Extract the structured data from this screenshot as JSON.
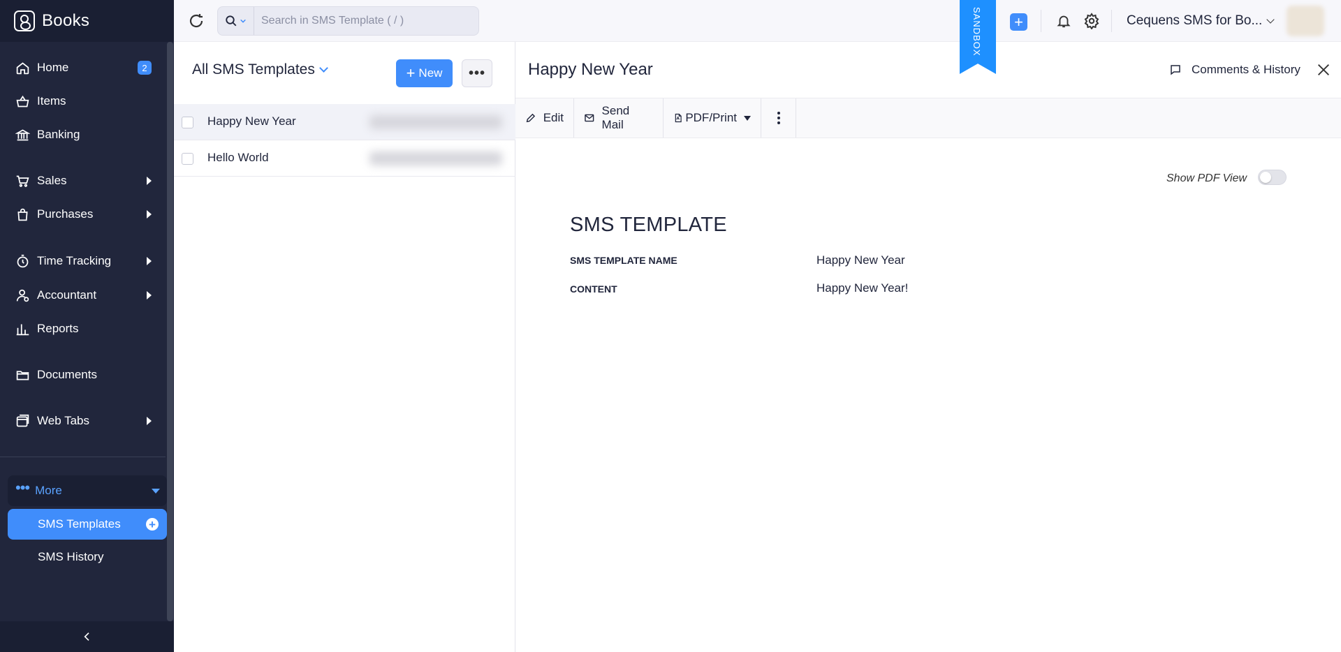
{
  "app": {
    "name": "Books"
  },
  "sidebar": {
    "items": [
      {
        "label": "Home",
        "icon": "home-icon",
        "badge": "2"
      },
      {
        "label": "Items",
        "icon": "basket-icon"
      },
      {
        "label": "Banking",
        "icon": "bank-icon"
      },
      {
        "label": "Sales",
        "icon": "cart-icon",
        "has_submenu": true
      },
      {
        "label": "Purchases",
        "icon": "bag-icon",
        "has_submenu": true
      },
      {
        "label": "Time Tracking",
        "icon": "timer-icon",
        "has_submenu": true
      },
      {
        "label": "Accountant",
        "icon": "user-icon",
        "has_submenu": true
      },
      {
        "label": "Reports",
        "icon": "bar-chart-icon"
      },
      {
        "label": "Documents",
        "icon": "folder-icon"
      },
      {
        "label": "Web Tabs",
        "icon": "tabs-icon",
        "has_submenu": true
      }
    ],
    "more": {
      "label": "More"
    },
    "sub_items": [
      {
        "label": "SMS Templates",
        "active": true
      },
      {
        "label": "SMS History",
        "active": false
      }
    ]
  },
  "topbar": {
    "search_placeholder": "Search in SMS Template ( / )",
    "sandbox_label": "SANDBOX",
    "org_name": "Cequens SMS for Bo..."
  },
  "list": {
    "view_title": "All SMS Templates",
    "new_label": "New",
    "more_label": "•••",
    "rows": [
      {
        "name": "Happy New Year",
        "selected": true
      },
      {
        "name": "Hello World",
        "selected": false
      }
    ]
  },
  "detail": {
    "title": "Happy New Year",
    "comments_label": "Comments & History",
    "toolbar": {
      "edit_label": "Edit",
      "send_mail_label": "Send Mail",
      "pdf_print_label": "PDF/Print"
    },
    "show_pdf_view_label": "Show PDF View",
    "show_pdf_view_on": false,
    "doc": {
      "heading": "SMS TEMPLATE",
      "fields": [
        {
          "label": "SMS TEMPLATE NAME",
          "value": "Happy New Year"
        },
        {
          "label": "CONTENT",
          "value": "Happy New Year!"
        }
      ]
    }
  },
  "colors": {
    "sidebar_bg": "#21263c",
    "accent": "#408dfb",
    "sandbox": "#1e90ff"
  }
}
